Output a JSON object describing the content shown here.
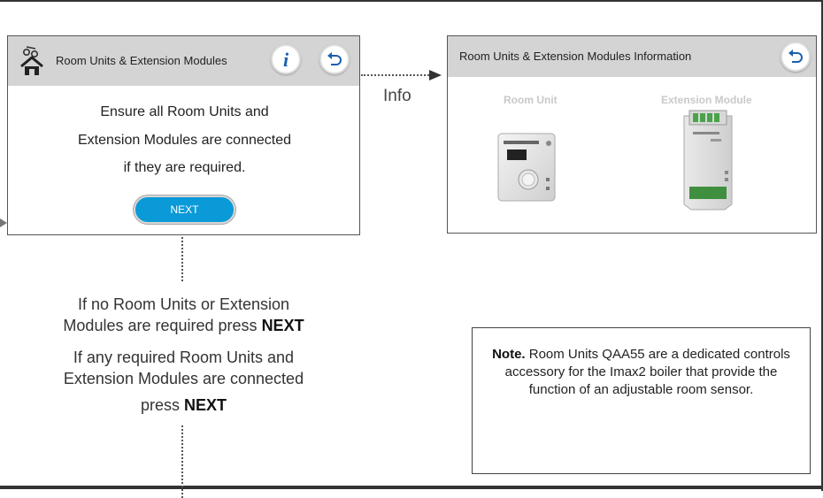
{
  "screen1": {
    "title": "Room Units & Extension Modules",
    "message_lines": [
      "Ensure all Room Units and",
      "Extension Modules are connected",
      "if they are required."
    ],
    "next_label": "NEXT",
    "info_glyph": "i"
  },
  "screen2": {
    "title": "Room Units & Extension Modules Information",
    "room_unit_label": "Room Unit",
    "extension_module_label": "Extension Module"
  },
  "connector": {
    "info_label": "Info"
  },
  "instructions": {
    "line1a": "If no Room Units or Extension",
    "line1b": "Modules are required press",
    "line2a": "If any required Room Units and",
    "line2b": "Extension Modules are connected",
    "line2c": "press",
    "emphasis": "NEXT"
  },
  "note": {
    "lead": "Note.",
    "text": "Room Units QAA55 are a dedicated controls accessory for the Imax2 boiler that provide the function of an adjustable room sensor."
  },
  "icons": [
    "home-icon",
    "info-icon",
    "back-arrow-icon",
    "arrow-right-icon"
  ],
  "colors": {
    "titlebar": "#d4d4d4",
    "next_button": "#0b9ad8",
    "info_icon": "#1c5fae",
    "back_icon": "#1c5fae"
  }
}
